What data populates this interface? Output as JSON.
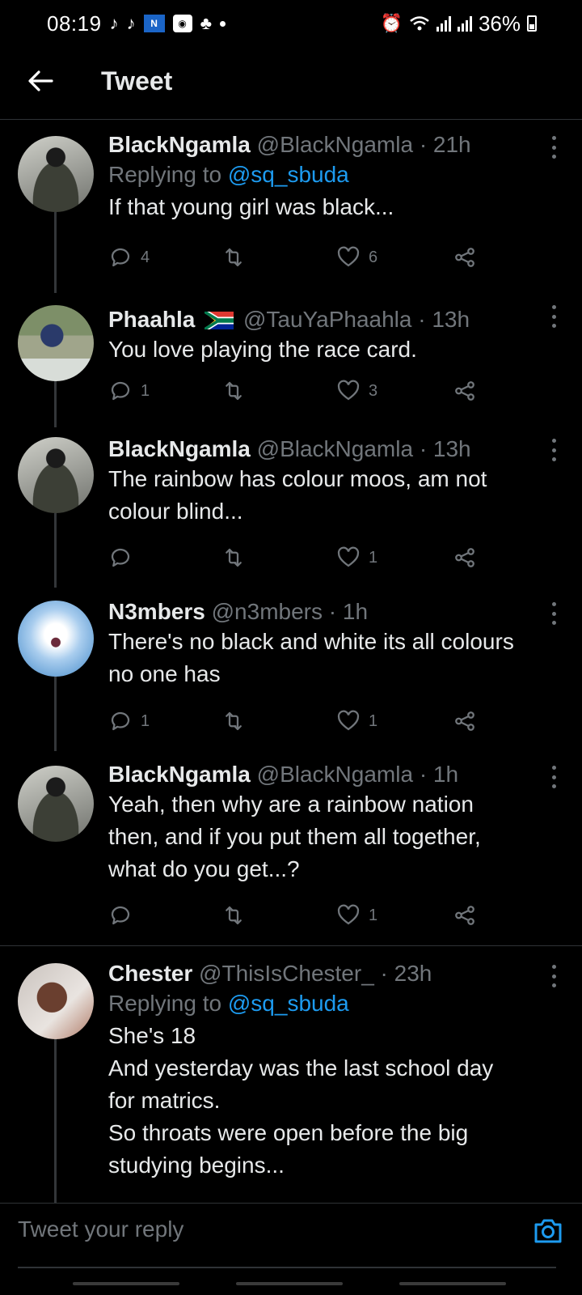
{
  "status_bar": {
    "time": "08:19",
    "battery": "36%",
    "left_icons": [
      "tiktok-icon",
      "tiktok-icon",
      "news-app-icon",
      "camera-app-icon",
      "bixby-icon",
      "dot-icon"
    ],
    "right_icons": [
      "alarm-icon",
      "wifi-icon",
      "signal-icon",
      "signal-icon",
      "battery-icon"
    ]
  },
  "header": {
    "title": "Tweet",
    "back_icon": "arrow-left-icon"
  },
  "tweets": [
    {
      "name": "BlackNgamla",
      "handle": "@BlackNgamla",
      "time": "· 21h",
      "replying_label": "Replying to",
      "replying_to": "@sq_sbuda",
      "text": "If that young girl was black...",
      "replies": "4",
      "retweets": "",
      "likes": "6"
    },
    {
      "name": "Phaahla",
      "flag": "south-africa-flag",
      "handle": "@TauYaPhaahla",
      "time": "· 13h",
      "text": "You love playing the race card.",
      "replies": "1",
      "retweets": "",
      "likes": "3"
    },
    {
      "name": "BlackNgamla",
      "handle": "@BlackNgamla",
      "time": "· 13h",
      "text": "The rainbow has colour moos, am not\ncolour blind...",
      "replies": "",
      "retweets": "",
      "likes": "1"
    },
    {
      "name": "N3mbers",
      "handle": "@n3mbers",
      "time": "· 1h",
      "text": "There's no black and white its all colours\nno one has",
      "replies": "1",
      "retweets": "",
      "likes": "1"
    },
    {
      "name": "BlackNgamla",
      "handle": "@BlackNgamla",
      "time": "· 1h",
      "text": "Yeah, then why are a rainbow nation\nthen, and if you put them all together,\nwhat do you get...?",
      "replies": "",
      "retweets": "",
      "likes": "1"
    },
    {
      "name": "Chester",
      "handle": "@ThisIsChester_",
      "time": "· 23h",
      "replying_label": "Replying to",
      "replying_to": "@sq_sbuda",
      "text": "She's 18\nAnd yesterday was the last school day\nfor matrics.\nSo throats were open before the big\nstudying begins..."
    }
  ],
  "composer": {
    "placeholder": "Tweet your reply",
    "icon": "camera-icon"
  },
  "colors": {
    "background": "#000000",
    "text": "#e7e9ea",
    "muted": "#71767b",
    "link": "#1d9bf0",
    "border": "#2f3336"
  }
}
